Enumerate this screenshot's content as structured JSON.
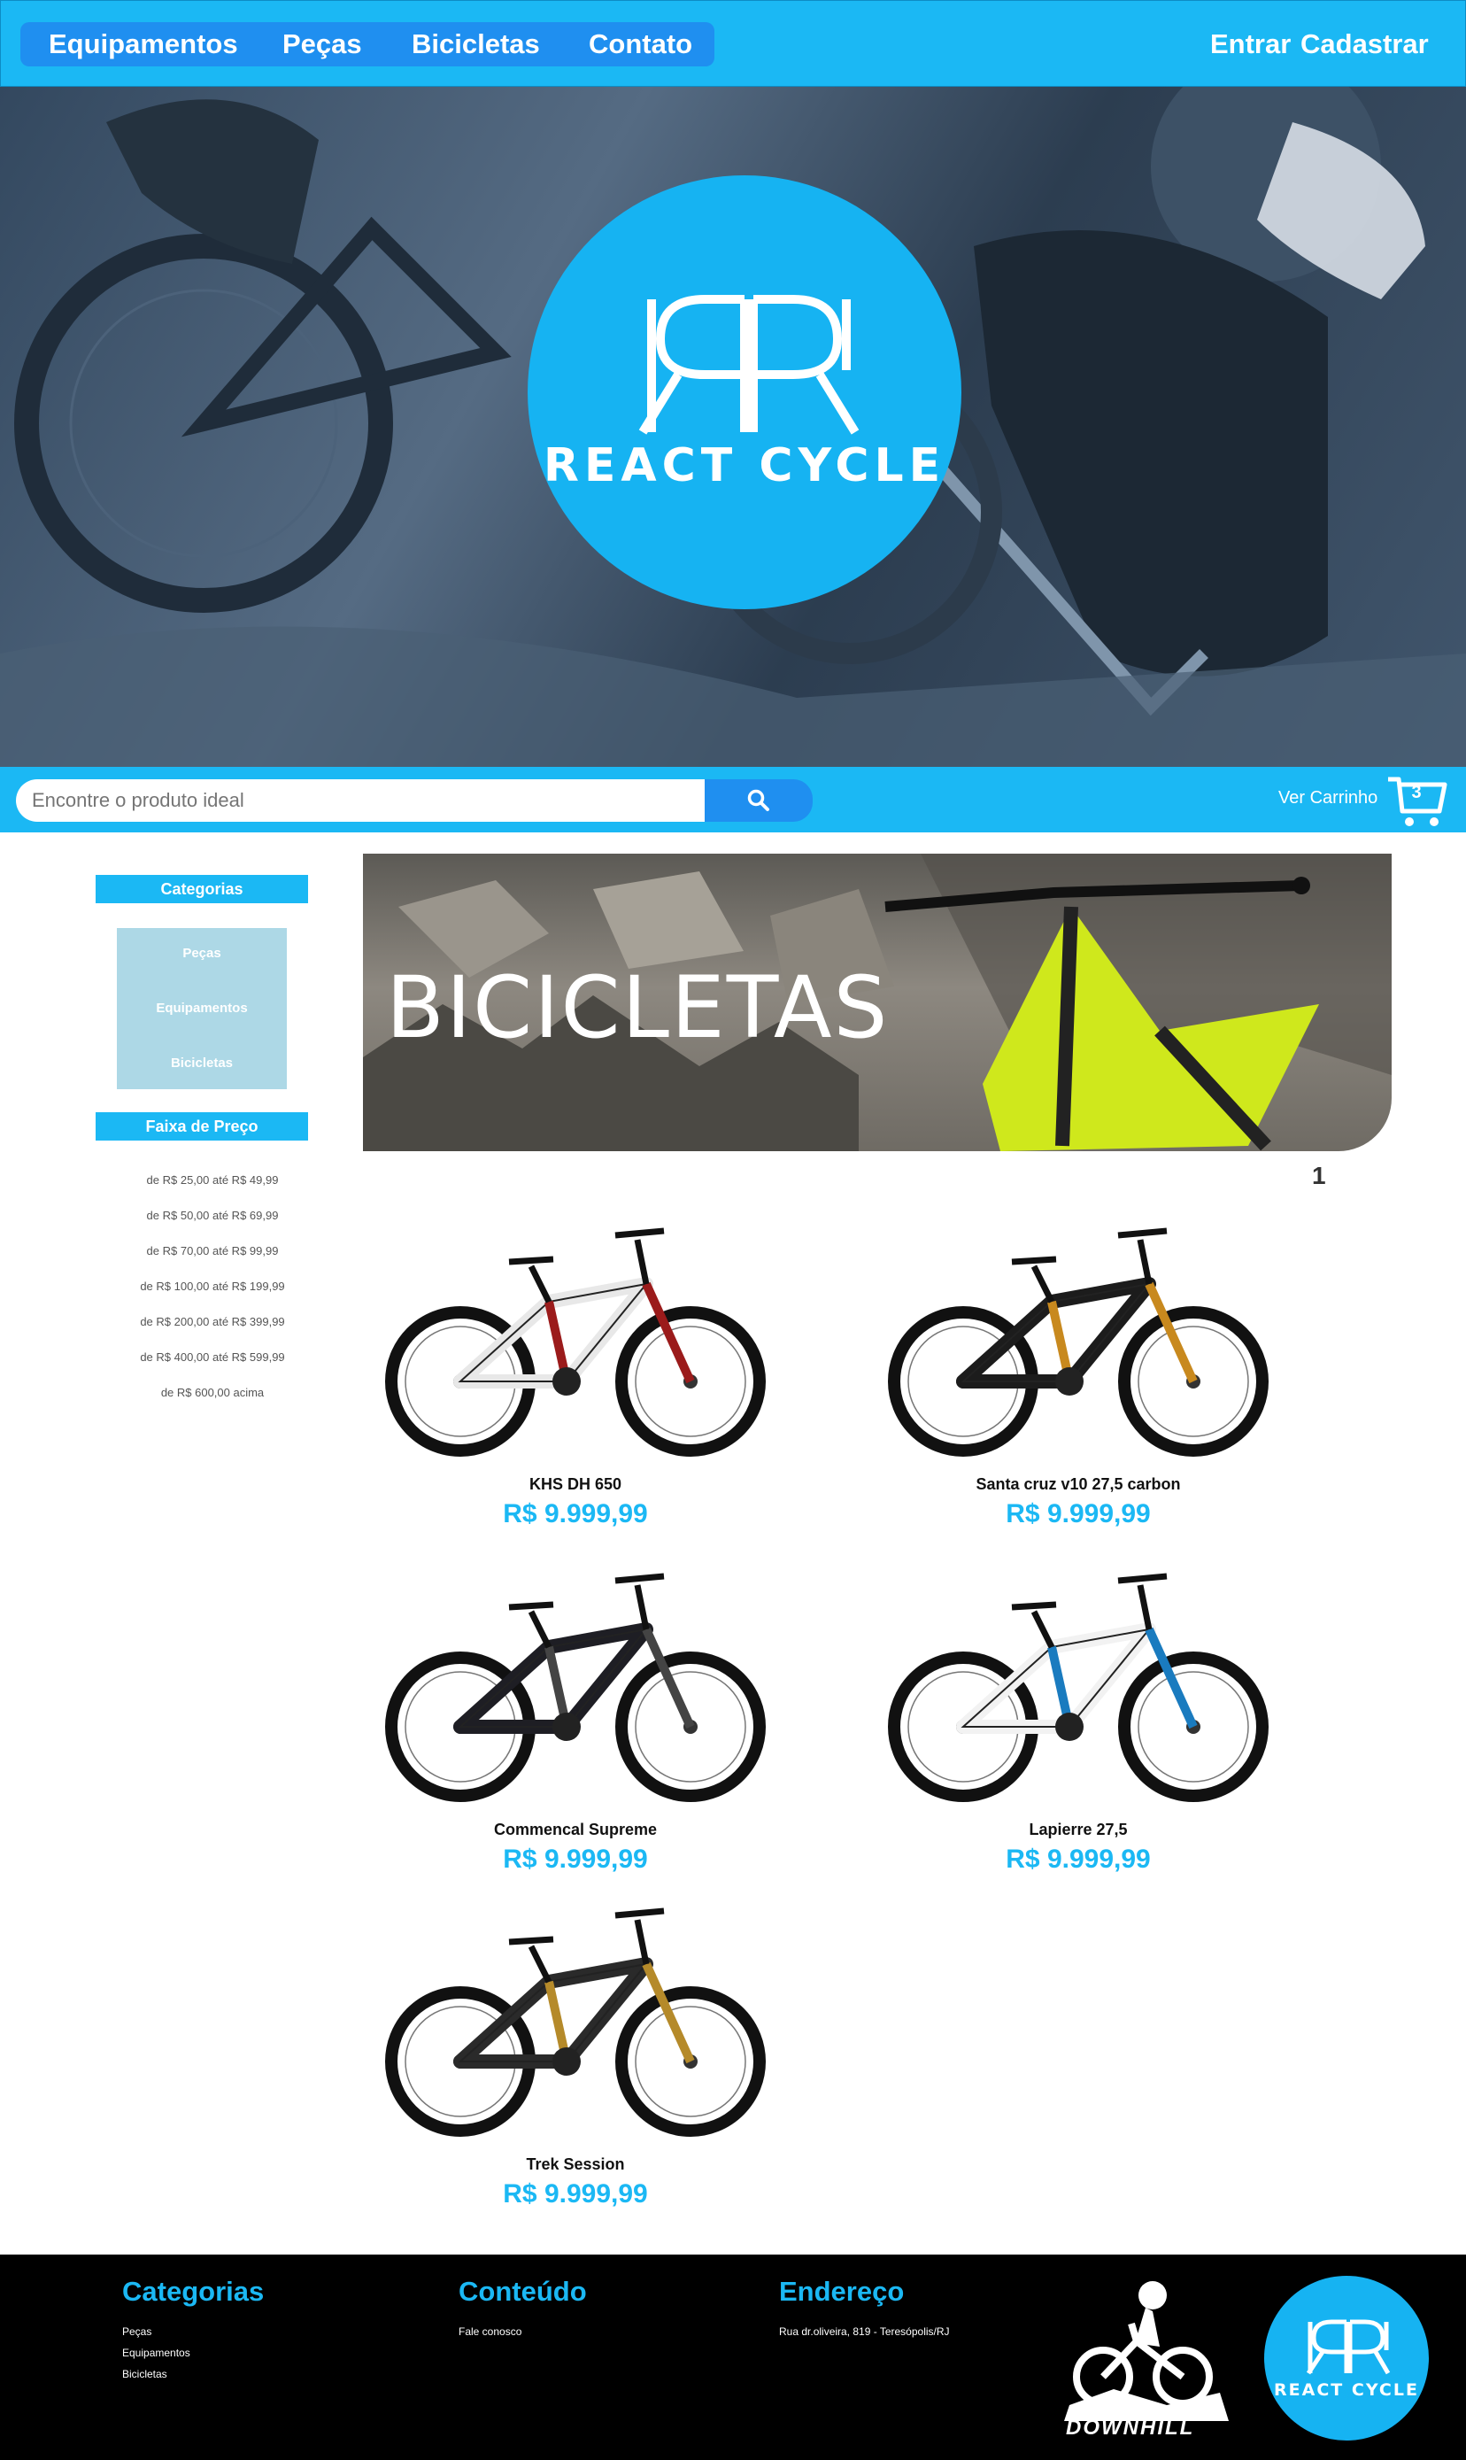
{
  "nav": {
    "items": [
      "Equipamentos",
      "Peças",
      "Bicicletas",
      "Contato"
    ],
    "login": "Entrar",
    "register": "Cadastrar"
  },
  "brand": {
    "name": "REACT CYCLE"
  },
  "search": {
    "placeholder": "Encontre o produto ideal",
    "icon": "search-icon"
  },
  "cart": {
    "label": "Ver Carrinho",
    "count": "3",
    "icon": "cart-icon"
  },
  "sidebar": {
    "categories_title": "Categorias",
    "categories": [
      "Peças",
      "Equipamentos",
      "Bicicletas"
    ],
    "price_title": "Faixa de Preço",
    "price_ranges": [
      "de R$ 25,00 até R$ 49,99",
      "de R$ 50,00 até R$ 69,99",
      "de R$ 70,00 até R$ 99,99",
      "de R$ 100,00 até R$ 199,99",
      "de R$ 200,00 até R$ 399,99",
      "de R$ 400,00 até R$ 599,99",
      "de R$ 600,00 acima"
    ]
  },
  "banner": {
    "title": "BICICLETAS"
  },
  "pagination": {
    "current": "1"
  },
  "products": [
    {
      "name": "KHS DH 650",
      "price": "R$ 9.999,99",
      "frame": "#e8e8e8",
      "accent": "#9b1b1b"
    },
    {
      "name": "Santa cruz v10 27,5 carbon",
      "price": "R$ 9.999,99",
      "frame": "#1c1c1c",
      "accent": "#c8891e"
    },
    {
      "name": "Commencal Supreme",
      "price": "R$ 9.999,99",
      "frame": "#1e1e24",
      "accent": "#444"
    },
    {
      "name": "Lapierre 27,5",
      "price": "R$ 9.999,99",
      "frame": "#f2f2f2",
      "accent": "#1a7bbf"
    },
    {
      "name": "Trek Session",
      "price": "R$ 9.999,99",
      "frame": "#2a2a2a",
      "accent": "#b58a2a"
    }
  ],
  "footer": {
    "categories_title": "Categorias",
    "categories": [
      "Peças",
      "Equipamentos",
      "Bicicletas"
    ],
    "content_title": "Conteúdo",
    "content_links": [
      "Fale conosco"
    ],
    "address_title": "Endereço",
    "address": "Rua dr.oliveira, 819 - Teresópolis/RJ",
    "downhill_label": "DOWNHILL"
  },
  "colors": {
    "primary": "#1bb8f4",
    "nav_pill": "#1f8ff0",
    "sidebar_box": "#add8e6",
    "footer_bg": "#000000"
  }
}
